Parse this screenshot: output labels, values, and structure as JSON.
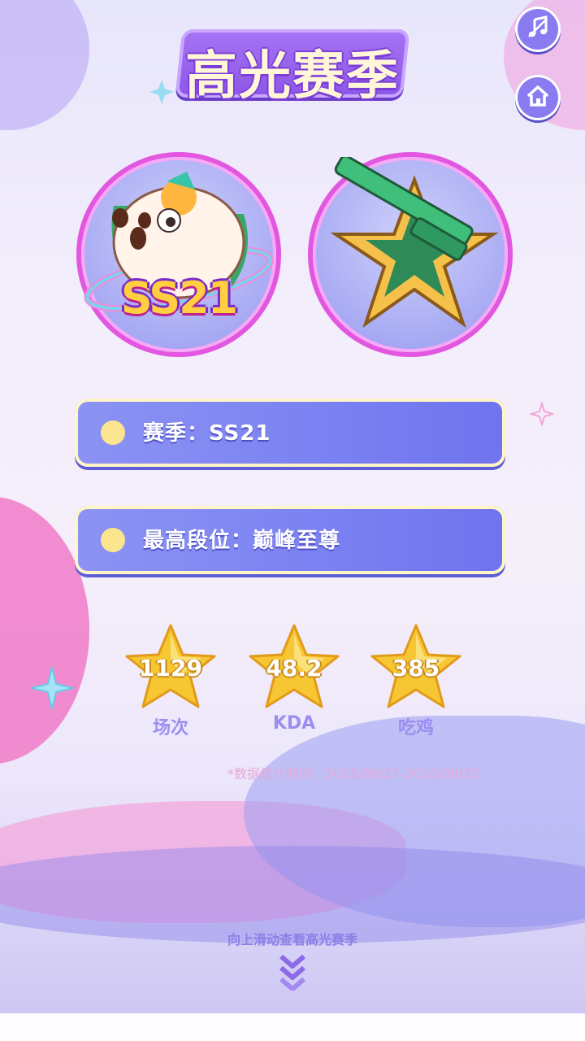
{
  "header": {
    "title": "高光赛季",
    "music_icon": "music-note-icon",
    "home_icon": "home-icon"
  },
  "badges": {
    "season_badge_text": "SS21",
    "season_badge_icon": "season-mascot-icon",
    "rank_badge_icon": "rank-star-gun-icon"
  },
  "info": {
    "season": "赛季：SS21",
    "highest_rank": "最高段位：巅峰至尊"
  },
  "stats": [
    {
      "value": "1129",
      "label": "场次"
    },
    {
      "value": "48.2",
      "label": "KDA"
    },
    {
      "value": "385",
      "label": "吃鸡"
    }
  ],
  "timestamp": "*数据统计时间：2025/06/27-2026/08/25",
  "footer": {
    "swipe_hint": "向上滑动查看高光赛季",
    "chevron_icon": "double-chevron-down-icon"
  },
  "colors": {
    "accent_purple": "#8c56e8",
    "pill_blue": "#7d84f2",
    "badge_ring": "#e357e0",
    "star_gold": "#f6c633"
  }
}
